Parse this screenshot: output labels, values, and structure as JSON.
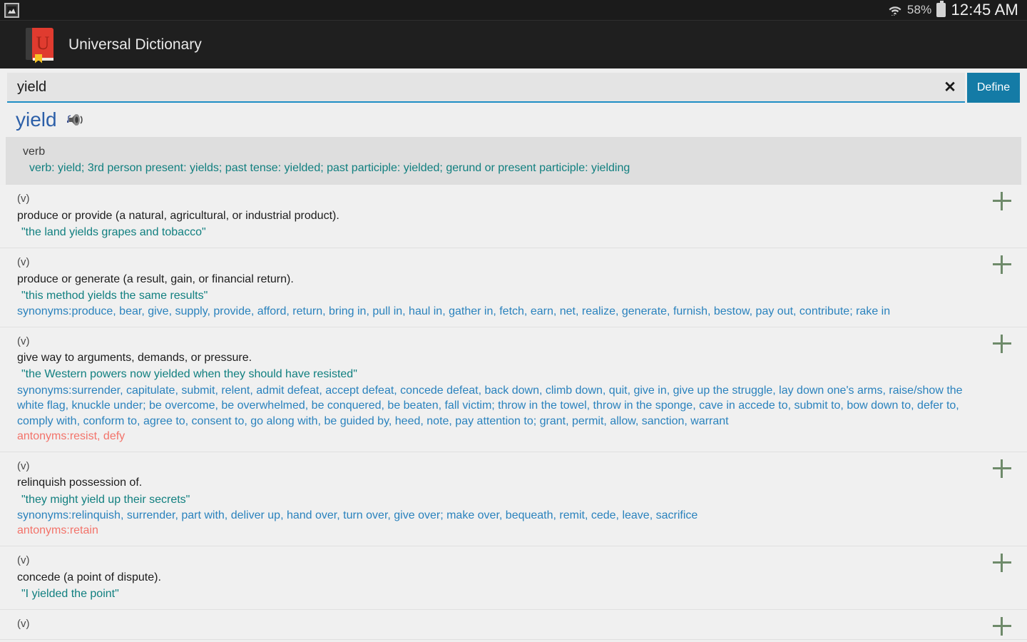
{
  "statusbar": {
    "notification_icon": "screenshot-image-icon",
    "wifi_icon": "wifi-icon",
    "battery_percent": "58%",
    "battery_icon": "battery-icon",
    "time": "12:45 AM"
  },
  "appbar": {
    "icon": "dictionary-book-icon",
    "icon_letter": "U",
    "title": "Universal Dictionary"
  },
  "search": {
    "value": "yield",
    "placeholder": "",
    "clear_icon": "✕",
    "define_label": "Define"
  },
  "headword": {
    "word": "yield",
    "speaker_icon": "speaker-sound-icon"
  },
  "part_of_speech": {
    "name": "verb",
    "inflections": "verb: yield; 3rd person present: yields; past tense: yielded; past participle: yielded; gerund or present participle: yielding"
  },
  "definitions": [
    {
      "pos": "(v)",
      "text": "produce or provide (a natural, agricultural, or industrial product).",
      "example": "\"the land yields grapes and tobacco\"",
      "synonyms": "",
      "antonyms": "",
      "add_icon": "plus-icon"
    },
    {
      "pos": "(v)",
      "text": "produce or generate (a result, gain, or financial return).",
      "example": "\"this method yields the same results\"",
      "synonyms": "synonyms:produce, bear, give, supply, provide, afford, return, bring in, pull in, haul in, gather in, fetch, earn, net, realize, generate, furnish, bestow, pay out, contribute; rake in",
      "antonyms": "",
      "add_icon": "plus-icon"
    },
    {
      "pos": "(v)",
      "text": "give way to arguments, demands, or pressure.",
      "example": "\"the Western powers now yielded when they should have resisted\"",
      "synonyms": "synonyms:surrender, capitulate, submit, relent, admit defeat, accept defeat, concede defeat, back down, climb down, quit, give in, give up the struggle, lay down one's arms, raise/show the white flag, knuckle under; be overcome, be overwhelmed, be conquered, be beaten, fall victim; throw in the towel, throw in the sponge, cave in accede to, submit to, bow down to, defer to, comply with, conform to, agree to, consent to, go along with, be guided by, heed, note, pay attention to; grant, permit, allow, sanction, warrant",
      "antonyms": "antonyms:resist, defy",
      "add_icon": "plus-icon"
    },
    {
      "pos": "(v)",
      "text": "relinquish possession of.",
      "example": "\"they might yield up their secrets\"",
      "synonyms": "synonyms:relinquish, surrender, part with, deliver up, hand over, turn over, give over; make over, bequeath, remit, cede, leave, sacrifice",
      "antonyms": "antonyms:retain",
      "add_icon": "plus-icon"
    },
    {
      "pos": "(v)",
      "text": "concede (a point of dispute).",
      "example": "\"I yielded the point\"",
      "synonyms": "",
      "antonyms": "",
      "add_icon": "plus-icon"
    },
    {
      "pos": "(v)",
      "text": "",
      "example": "",
      "synonyms": "",
      "antonyms": "",
      "add_icon": "plus-icon"
    }
  ],
  "colors": {
    "accent_blue": "#147ba6",
    "headword_blue": "#2c5fa8",
    "teal": "#107f7f",
    "synonym_blue": "#2a82bd",
    "antonym_red": "#f3736a",
    "plus_green": "#6e8a6a",
    "appbar_dark": "#1f1f1f"
  }
}
